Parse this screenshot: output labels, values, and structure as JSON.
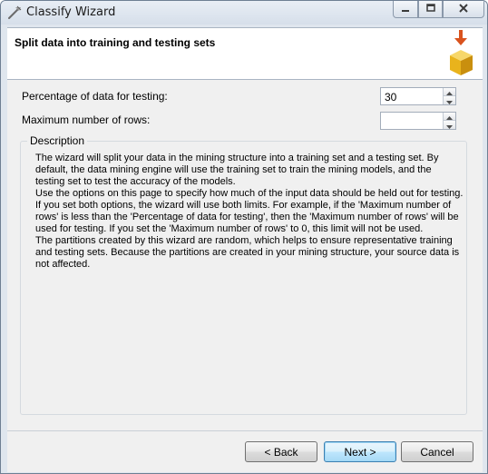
{
  "window": {
    "title": "Classify Wizard"
  },
  "header": {
    "title": "Split data into training and testing sets"
  },
  "fields": {
    "percentage_label": "Percentage of data for testing:",
    "percentage_value": "30",
    "max_rows_label": "Maximum number of rows:",
    "max_rows_value": ""
  },
  "description": {
    "legend": "Description",
    "paragraphs": [
      "The wizard will split your data in the mining structure into a training set and a testing set. By default, the data mining engine will use the training set to train the mining models, and the testing set to test the accuracy of the models.",
      "Use the options on this page to specify how much of the input data should be held out for testing. If you set both options, the wizard will use both limits. For example, if the 'Maximum number of rows' is less than the 'Percentage of data for testing', then the 'Maximum number of rows' will be used for testing. If you set the 'Maximum number of rows' to 0, this limit will not be used.",
      "The partitions created by this wizard are random, which helps to ensure representative training and testing sets. Because the partitions are created in your mining structure, your source data is not affected."
    ]
  },
  "buttons": {
    "back": "< Back",
    "next": "Next >",
    "cancel": "Cancel"
  },
  "icons": {
    "app": "wizard-wand-icon",
    "header": "cube-arrow-icon",
    "minimize": "minimize-icon",
    "maximize": "maximize-icon",
    "close": "close-icon"
  }
}
